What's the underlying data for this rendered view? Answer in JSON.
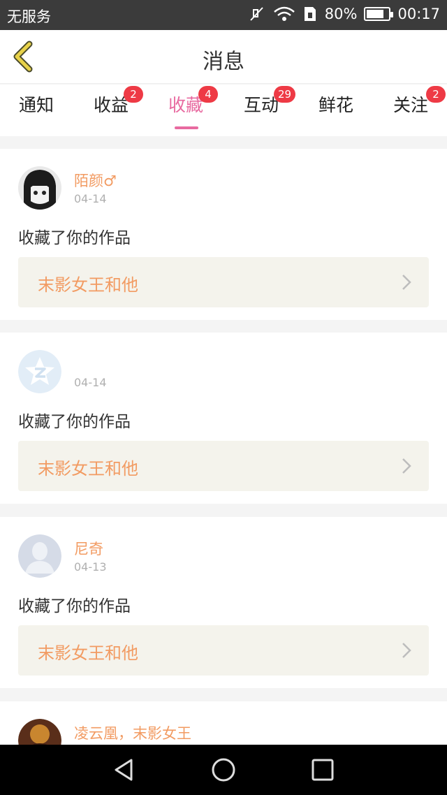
{
  "status_bar": {
    "carrier": "无服务",
    "battery": "80%",
    "battery_level": 0.8,
    "time": "00:17"
  },
  "header": {
    "title": "消息"
  },
  "tabs": [
    {
      "label": "通知",
      "badge": ""
    },
    {
      "label": "收益",
      "badge": "2"
    },
    {
      "label": "收藏",
      "badge": "4",
      "active": true
    },
    {
      "label": "互动",
      "badge": "29"
    },
    {
      "label": "鲜花",
      "badge": ""
    },
    {
      "label": "关注",
      "badge": "2"
    }
  ],
  "items": [
    {
      "user": "陌颜♂",
      "date": "04-14",
      "action": "收藏了你的作品",
      "work": "末影女王和他",
      "avatar": "anime-girl-avatar"
    },
    {
      "user": "",
      "date": "04-14",
      "action": "收藏了你的作品",
      "work": "末影女王和他",
      "avatar": "qq-star-avatar"
    },
    {
      "user": "尼奇",
      "date": "04-13",
      "action": "收藏了你的作品",
      "work": "末影女王和他",
      "avatar": "default-person-avatar"
    },
    {
      "user": "凌云凰，末影女王",
      "date": "",
      "action": "",
      "work": "",
      "avatar": "photo-avatar"
    }
  ],
  "colors": {
    "accent_pink": "#e86aa0",
    "name_orange": "#f29b62",
    "badge_red": "#ee3a45",
    "work_bg": "#f4f3ec"
  }
}
